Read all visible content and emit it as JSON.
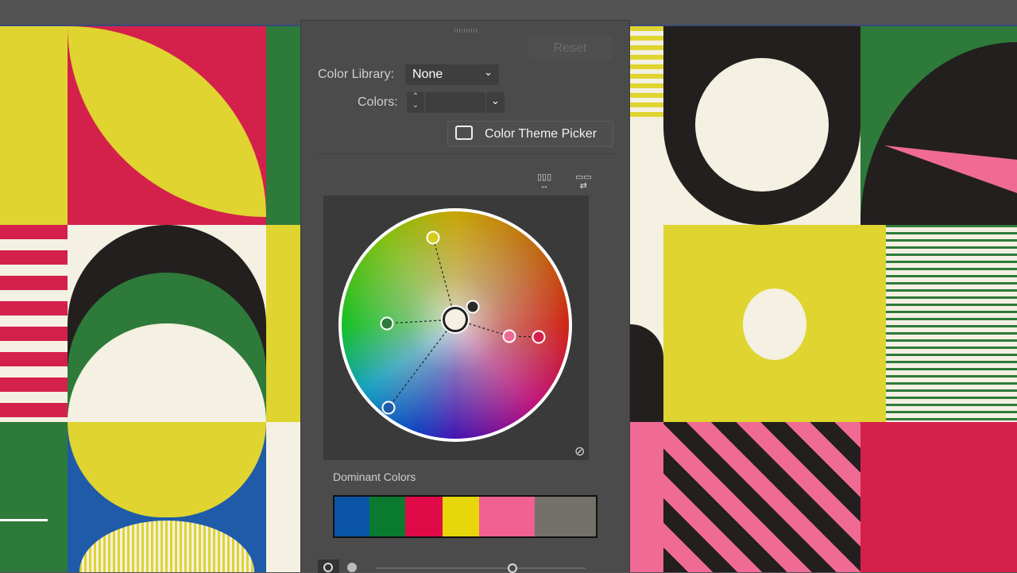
{
  "panel": {
    "reset_label": "Reset",
    "color_library_label": "Color Library:",
    "color_library_value": "None",
    "colors_label": "Colors:",
    "colors_value": "",
    "theme_picker_label": "Color Theme Picker",
    "dominant_colors_label": "Dominant Colors",
    "dominant_colors": [
      {
        "name": "blue",
        "color": "#0a55a8",
        "share": 0.135
      },
      {
        "name": "green",
        "color": "#0a7a30",
        "share": 0.135
      },
      {
        "name": "crimson",
        "color": "#e00a48",
        "share": 0.142
      },
      {
        "name": "yellow",
        "color": "#e6d60a",
        "share": 0.142
      },
      {
        "name": "pink",
        "color": "#f06090",
        "share": 0.213
      },
      {
        "name": "gray",
        "color": "#74706a",
        "share": 0.233
      }
    ]
  },
  "colors": {
    "accent": "#ffffff",
    "artwork_yellow": "#dfd430",
    "artwork_red": "#d4214b",
    "artwork_green": "#2e7a3a",
    "artwork_cream": "#f4f0e2",
    "artwork_black": "#231f1e",
    "artwork_pink": "#ef6b95",
    "artwork_blue": "#1f5ba8"
  }
}
